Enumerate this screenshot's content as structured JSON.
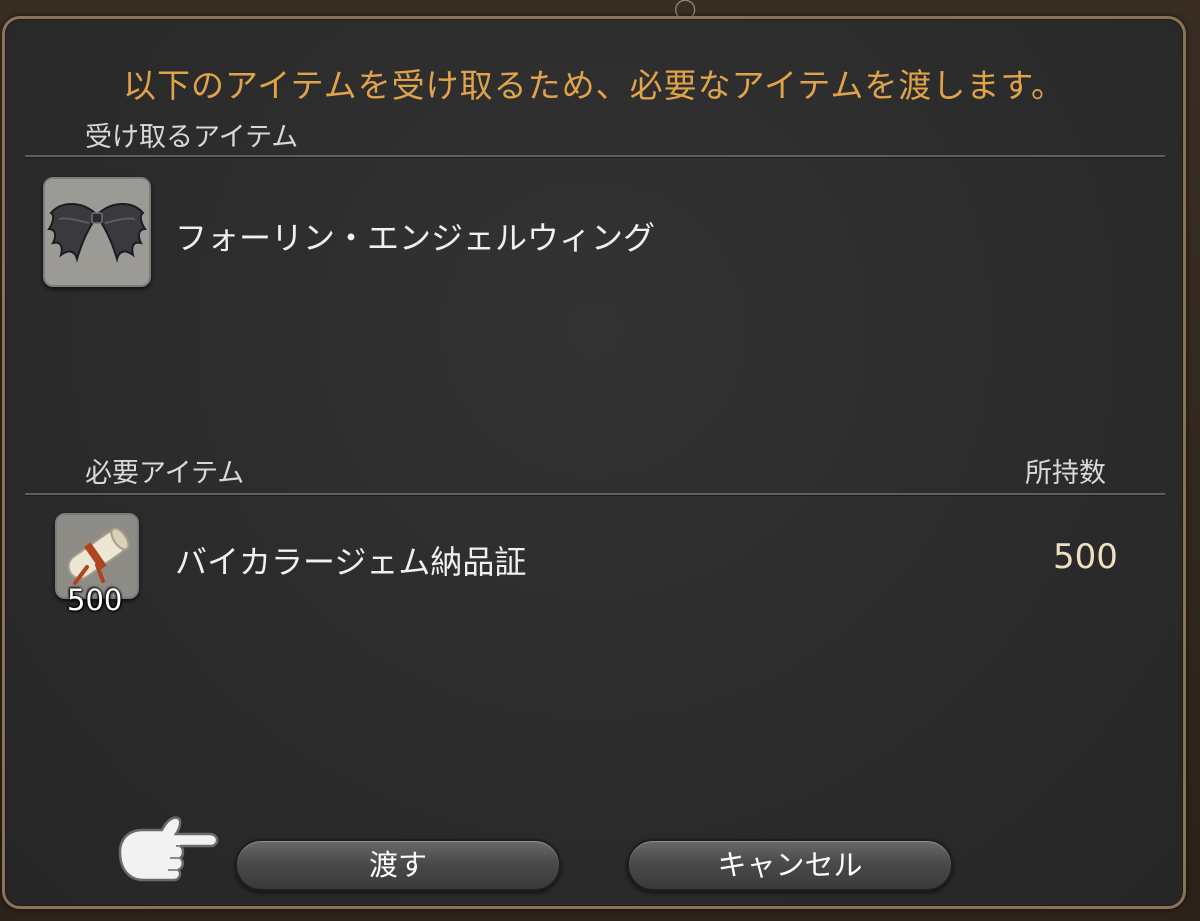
{
  "dialog": {
    "prompt": "以下のアイテムを受け取るため、必要なアイテムを渡します。",
    "receive_section": {
      "label": "受け取るアイテム",
      "item": {
        "name": "フォーリン・エンジェルウィング",
        "icon": "wings-icon"
      }
    },
    "required_section": {
      "label": "必要アイテム",
      "owned_header": "所持数",
      "item": {
        "name": "バイカラージェム納品証",
        "icon": "scroll-icon",
        "quantity": "500",
        "owned": "500"
      }
    },
    "buttons": {
      "hand_over": "渡す",
      "cancel": "キャンセル"
    },
    "cursor": "pointing-hand-icon"
  },
  "colors": {
    "prompt": "#e0a34a",
    "frame_border": "#8a7458",
    "owned_value": "#eee0c0"
  }
}
